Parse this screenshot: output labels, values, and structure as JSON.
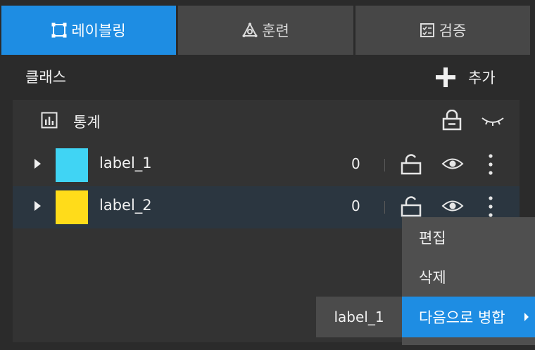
{
  "tabs": [
    {
      "label": "레이블링",
      "icon": "labeling-icon",
      "active": true
    },
    {
      "label": "훈련",
      "icon": "training-icon",
      "active": false
    },
    {
      "label": "검증",
      "icon": "validation-icon",
      "active": false
    }
  ],
  "header": {
    "title": "클래스",
    "add_label": "추가"
  },
  "stats": {
    "label": "통계"
  },
  "classes": [
    {
      "name": "label_1",
      "count": "0",
      "color": "#40d4f4"
    },
    {
      "name": "label_2",
      "count": "0",
      "color": "#ffdc1a"
    }
  ],
  "context_menu": {
    "items": [
      "편집",
      "삭제",
      "다음으로 병합"
    ]
  },
  "submenu": {
    "items": [
      "label_1"
    ]
  },
  "colors": {
    "accent": "#1e8de3",
    "background": "#2b2b2b",
    "panel": "#333333"
  }
}
